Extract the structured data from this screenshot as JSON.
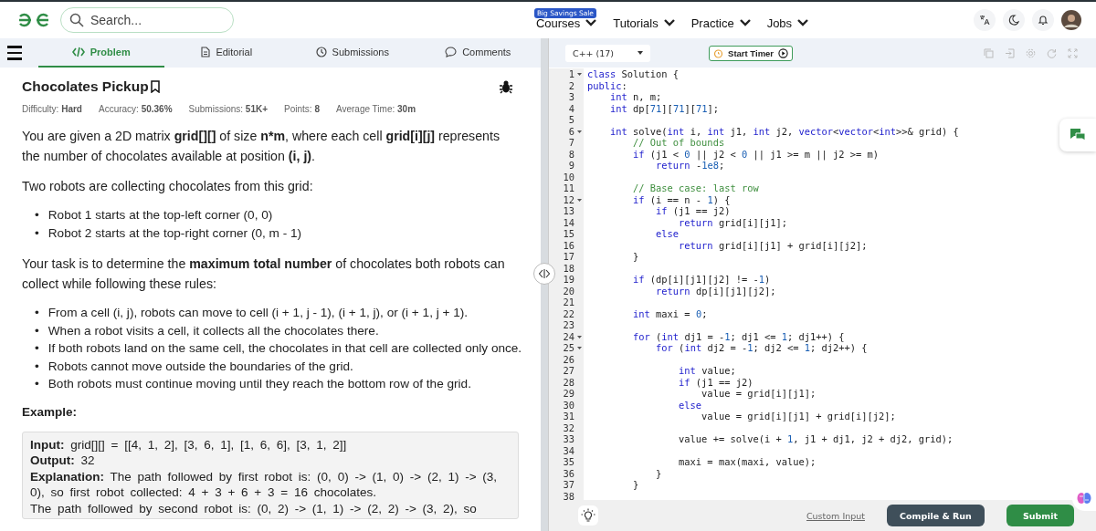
{
  "header": {
    "search": {
      "placeholder": "Search..."
    },
    "nav": [
      {
        "label": "Courses",
        "badge": "Big Savings Sale"
      },
      {
        "label": "Tutorials"
      },
      {
        "label": "Practice"
      },
      {
        "label": "Jobs"
      }
    ]
  },
  "problem_tabs": [
    {
      "label": "Problem",
      "selected": true
    },
    {
      "label": "Editorial",
      "selected": false
    },
    {
      "label": "Submissions",
      "selected": false
    },
    {
      "label": "Comments",
      "selected": false
    }
  ],
  "problem": {
    "title": "Chocolates Pickup",
    "meta": [
      {
        "label": "Difficulty:",
        "value": "Hard"
      },
      {
        "label": "Accuracy:",
        "value": "50.36%"
      },
      {
        "label": "Submissions:",
        "value": "51K+"
      },
      {
        "label": "Points:",
        "value": "8"
      },
      {
        "label": "Average Time:",
        "value": "30m"
      }
    ],
    "blocks": [
      {
        "kind": "para",
        "text": "You are given a 2D matrix **grid[][]** of size **n*m**, where each cell **grid[i][j]** represents the number of chocolates available at position **(i, j)**."
      },
      {
        "kind": "para",
        "text": "Two robots are collecting chocolates from this grid:"
      },
      {
        "kind": "list",
        "marker": "•",
        "items": [
          "Robot 1 starts at the top-left corner (0, 0)",
          "Robot 2 starts at the top-right corner (0, m - 1)"
        ]
      },
      {
        "kind": "para",
        "text": "Your task is to determine the **maximum total number** of chocolates both robots can collect while following these rules:"
      },
      {
        "kind": "list",
        "marker": "•",
        "items": [
          "From a cell (i, j), robots can move to cell (i + 1, j - 1), (i + 1, j), or (i + 1, j + 1).",
          "When a robot visits a cell, it collects all the chocolates there.",
          "If both robots land on the same cell, the chocolates in that cell are collected only once.",
          "Robots cannot move outside the boundaries of the grid.",
          "Both robots must continue moving until they reach the bottom row of the grid."
        ]
      },
      {
        "kind": "heading",
        "text": "Example:"
      },
      {
        "kind": "example",
        "lines": [
          "**Input:** grid[][] = [[4, 1, 2], [3, 6, 1], [1, 6, 6], [3, 1, 2]]",
          "**Output:** 32",
          "**Explanation:** The path followed by first robot is: (0, 0) -> (1, 0) -> (2, 1) -> (3, 0), so first robot collected: 4 + 3 + 6 + 3 = 16 chocolates.",
          "The path followed by second robot is: (0, 2) -> (1, 1) -> (2, 2) -> (3, 2), so"
        ]
      }
    ]
  },
  "editor": {
    "language": "C++ (17)",
    "timer_button": "Start Timer",
    "lines": [
      {
        "number": "1",
        "text": "class Solution {",
        "foldable": true
      },
      {
        "number": "2",
        "text": "public:",
        "foldable": false
      },
      {
        "number": "3",
        "text": "    int n, m;",
        "foldable": false
      },
      {
        "number": "4",
        "text": "    int dp[71][71][71];",
        "foldable": false
      },
      {
        "number": "5",
        "foldable": false
      },
      {
        "number": "6",
        "text": "    int solve(int i, int j1, int j2, vector<vector<int>>& grid) {",
        "foldable": true
      },
      {
        "number": "7",
        "text": "        // Out of bounds",
        "foldable": false
      },
      {
        "number": "8",
        "text": "        if (j1 < 0 || j2 < 0 || j1 >= m || j2 >= m)",
        "foldable": false
      },
      {
        "number": "9",
        "text": "            return -1e8;",
        "foldable": false
      },
      {
        "number": "10",
        "foldable": false
      },
      {
        "number": "11",
        "text": "        // Base case: last row",
        "foldable": false
      },
      {
        "number": "12",
        "text": "        if (i == n - 1) {",
        "foldable": true
      },
      {
        "number": "13",
        "text": "            if (j1 == j2)",
        "foldable": false
      },
      {
        "number": "14",
        "text": "                return grid[i][j1];",
        "foldable": false
      },
      {
        "number": "15",
        "text": "            else",
        "foldable": false
      },
      {
        "number": "16",
        "text": "                return grid[i][j1] + grid[i][j2];",
        "foldable": false
      },
      {
        "number": "17",
        "text": "        }",
        "foldable": false
      },
      {
        "number": "18",
        "foldable": false
      },
      {
        "number": "19",
        "text": "        if (dp[i][j1][j2] != -1)",
        "foldable": false
      },
      {
        "number": "20",
        "text": "            return dp[i][j1][j2];",
        "foldable": false
      },
      {
        "number": "21",
        "foldable": false
      },
      {
        "number": "22",
        "text": "        int maxi = 0;",
        "foldable": false
      },
      {
        "number": "23",
        "foldable": false
      },
      {
        "number": "24",
        "text": "        for (int dj1 = -1; dj1 <= 1; dj1++) {",
        "foldable": true
      },
      {
        "number": "25",
        "text": "            for (int dj2 = -1; dj2 <= 1; dj2++) {",
        "foldable": true
      },
      {
        "number": "26",
        "foldable": false
      },
      {
        "number": "27",
        "text": "                int value;",
        "foldable": false
      },
      {
        "number": "28",
        "text": "                if (j1 == j2)",
        "foldable": false
      },
      {
        "number": "29",
        "text": "                    value = grid[i][j1];",
        "foldable": false
      },
      {
        "number": "30",
        "text": "                else",
        "foldable": false
      },
      {
        "number": "31",
        "text": "                    value = grid[i][j1] + grid[i][j2];",
        "foldable": false
      },
      {
        "number": "32",
        "foldable": false
      },
      {
        "number": "33",
        "text": "                value += solve(i + 1, j1 + dj1, j2 + dj2, grid);",
        "foldable": false
      },
      {
        "number": "34",
        "foldable": false
      },
      {
        "number": "35",
        "text": "                maxi = max(maxi, value);",
        "foldable": false
      },
      {
        "number": "36",
        "text": "            }",
        "foldable": false
      },
      {
        "number": "37",
        "text": "        }",
        "foldable": false
      },
      {
        "number": "38",
        "foldable": false
      }
    ],
    "footer": {
      "custom_input": "Custom Input",
      "run_button": "Compile & Run",
      "submit_button": "Submit"
    }
  }
}
